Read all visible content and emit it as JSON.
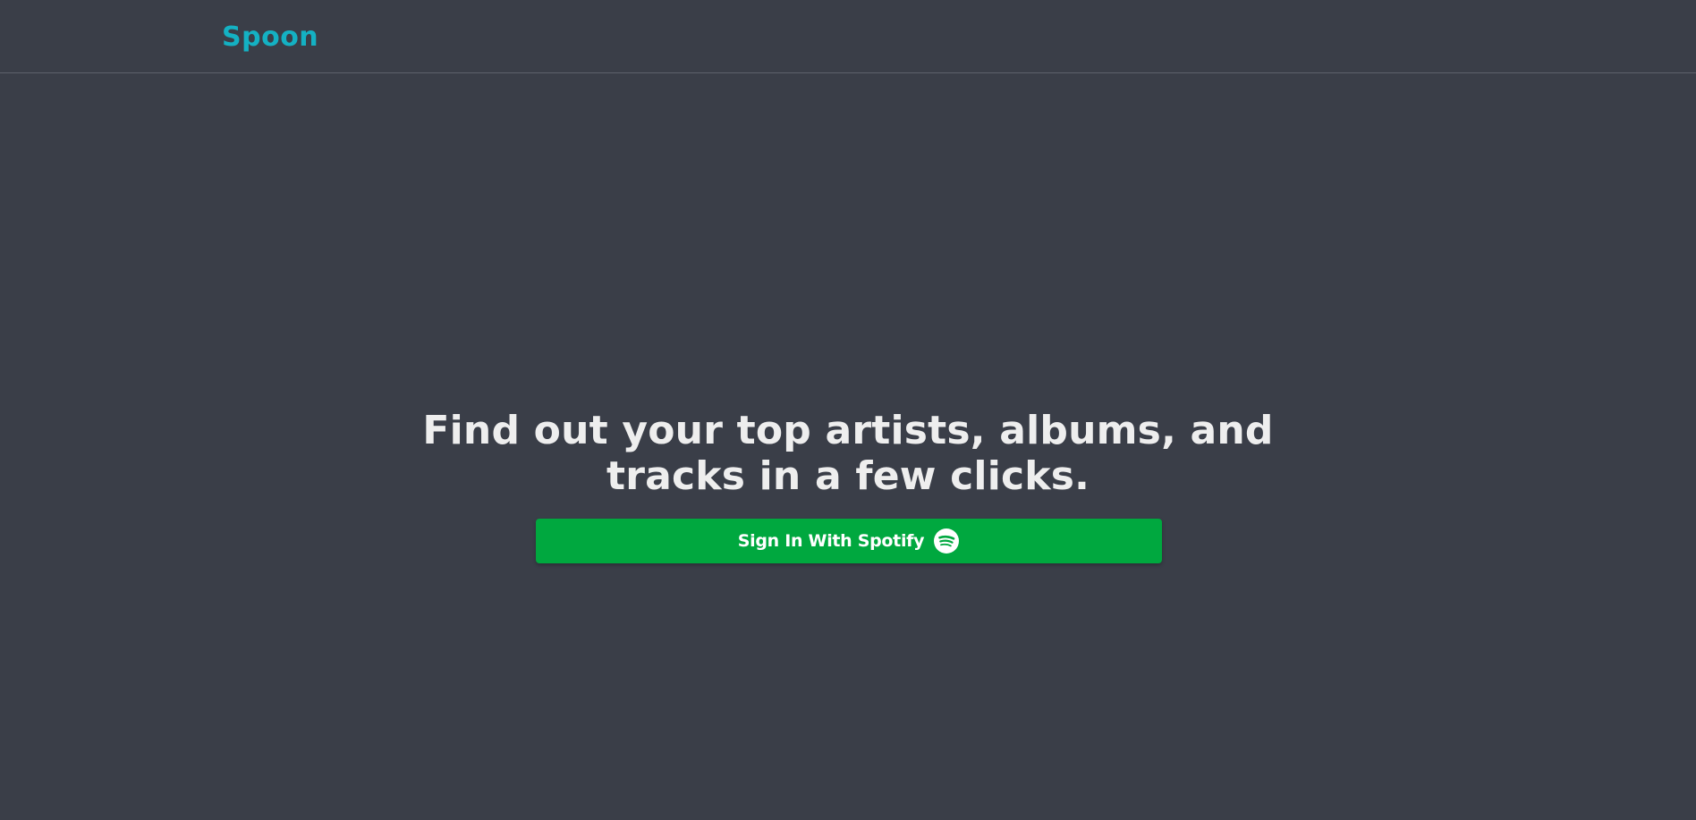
{
  "header": {
    "logo_text": "Spoon"
  },
  "hero": {
    "headline": "Find out your top artists, albums, and tracks in a few clicks.",
    "signin_button": {
      "label": "Sign In With Spotify",
      "icon": "spotify-icon"
    }
  },
  "colors": {
    "background": "#3a3e48",
    "brand_accent": "#14b1c3",
    "spotify_green": "#00a83f",
    "headline_text": "#eeeeee"
  }
}
